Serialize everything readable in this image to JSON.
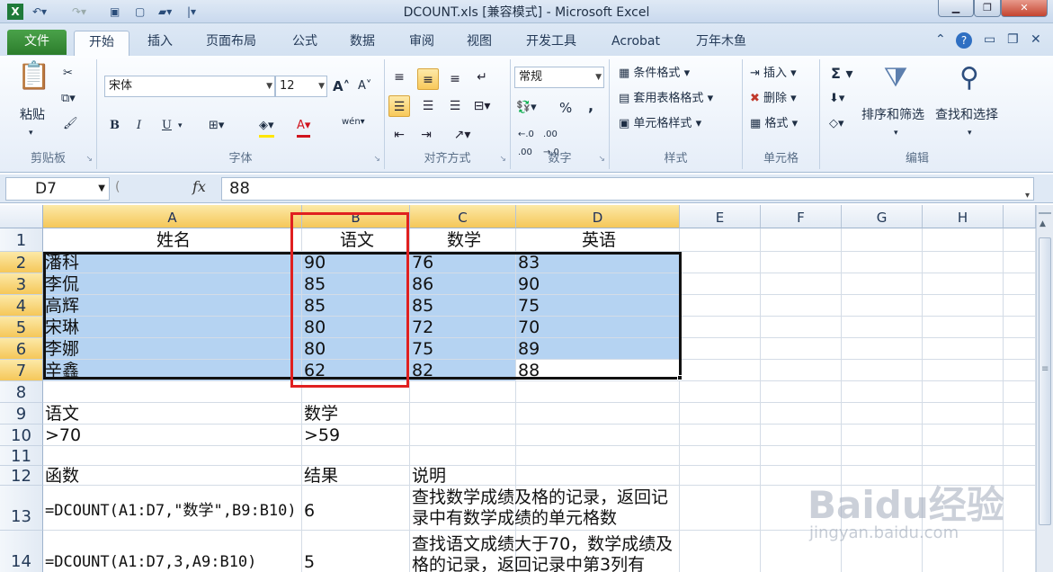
{
  "window": {
    "title": "DCOUNT.xls  [兼容模式]  -  Microsoft Excel"
  },
  "tabs": [
    "文件",
    "开始",
    "插入",
    "页面布局",
    "公式",
    "数据",
    "审阅",
    "视图",
    "开发工具",
    "Acrobat",
    "万年木鱼"
  ],
  "ribbon": {
    "clipboard": {
      "label": "剪贴板",
      "paste": "粘贴"
    },
    "font": {
      "label": "字体",
      "name": "宋体",
      "size": "12",
      "bold": "B",
      "italic": "I",
      "underline": "U",
      "grow": "A",
      "shrink": "A",
      "font_color": "A",
      "phonetic": "wén"
    },
    "alignment": {
      "label": "对齐方式"
    },
    "number": {
      "label": "数字",
      "format": "常规",
      "percent": "%",
      "comma": ","
    },
    "styles": {
      "label": "样式",
      "conditional": "条件格式",
      "table": "套用表格格式",
      "cell": "单元格样式"
    },
    "cells": {
      "label": "单元格",
      "insert": "插入",
      "delete": "删除",
      "format": "格式"
    },
    "editing": {
      "label": "编辑",
      "sum": "Σ",
      "sort": "排序和筛选",
      "find": "查找和选择"
    }
  },
  "formula_bar": {
    "name_box": "D7",
    "fx": "fx",
    "value": "88"
  },
  "columns": [
    "A",
    "B",
    "C",
    "D",
    "E",
    "F",
    "G",
    "H"
  ],
  "rows": [
    "1",
    "2",
    "3",
    "4",
    "5",
    "6",
    "7",
    "8",
    "9",
    "10",
    "11",
    "12",
    "13",
    "14"
  ],
  "sheet": {
    "r1": [
      "姓名",
      "语文",
      "数学",
      "英语"
    ],
    "r2": [
      "潘科",
      "90",
      "76",
      "83"
    ],
    "r3": [
      "李侃",
      "85",
      "86",
      "90"
    ],
    "r4": [
      "高辉",
      "85",
      "85",
      "75"
    ],
    "r5": [
      "宋琳",
      "80",
      "72",
      "70"
    ],
    "r6": [
      "李娜",
      "80",
      "75",
      "89"
    ],
    "r7": [
      "辛鑫",
      "62",
      "82",
      "88"
    ],
    "r9": [
      "语文",
      "数学"
    ],
    "r10": [
      ">70",
      ">59"
    ],
    "r12": [
      "函数",
      "结果",
      "说明"
    ],
    "r13": [
      "=DCOUNT(A1:D7,\"数学\",B9:B10)",
      "6",
      "查找数学成绩及格的记录，返回记录中有数学成绩的单元格数"
    ],
    "r14": [
      "=DCOUNT(A1:D7,3,A9:B10)",
      "5",
      "查找语文成绩大于70，数学成绩及格的记录，返回记录中第3列有"
    ]
  },
  "watermark": {
    "brand": "Baidu经验",
    "url": "jingyan.baidu.com"
  },
  "colors": {
    "selection": "#b5d3f2",
    "highlight_box": "#e02020",
    "file_tab": "#2c7d2c"
  }
}
